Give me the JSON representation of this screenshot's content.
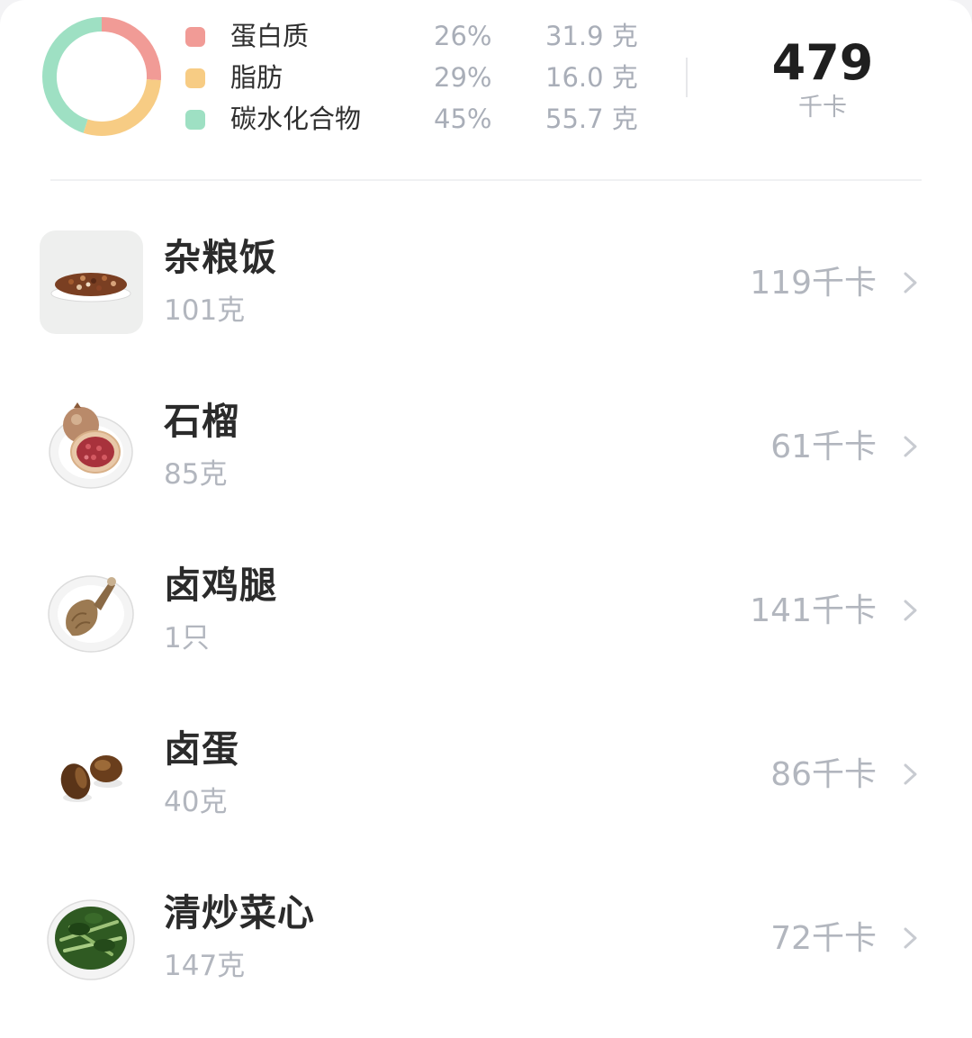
{
  "summary": {
    "macros": [
      {
        "name": "蛋白质",
        "percent": "26%",
        "amount": "31.9 克",
        "color": "#f19b96",
        "share": 0.26
      },
      {
        "name": "脂肪",
        "percent": "29%",
        "amount": "16.0 克",
        "color": "#f7cc84",
        "share": 0.29
      },
      {
        "name": "碳水化合物",
        "percent": "45%",
        "amount": "55.7 克",
        "color": "#9ee0c3",
        "share": 0.45
      }
    ],
    "total_kcal": "479",
    "total_unit": "千卡"
  },
  "foods": [
    {
      "name": "杂粮饭",
      "weight": "101克",
      "kcal": "119千卡",
      "icon": "mixed-grain-rice-photo"
    },
    {
      "name": "石榴",
      "weight": "85克",
      "kcal": "61千卡",
      "icon": "pomegranate-photo"
    },
    {
      "name": "卤鸡腿",
      "weight": "1只",
      "kcal": "141千卡",
      "icon": "braised-chicken-leg-photo"
    },
    {
      "name": "卤蛋",
      "weight": "40克",
      "kcal": "86千卡",
      "icon": "braised-egg-photo"
    },
    {
      "name": "清炒菜心",
      "weight": "147克",
      "kcal": "72千卡",
      "icon": "stir-fried-greens-photo"
    }
  ]
}
